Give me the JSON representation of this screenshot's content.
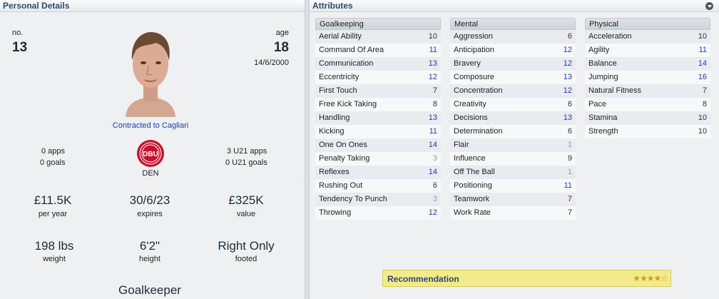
{
  "left_panel": {
    "title": "Personal Details",
    "no_label": "no.",
    "no_value": "13",
    "age_label": "age",
    "age_value": "18",
    "dob": "14/6/2000",
    "contract_text": "Contracted to Cagliari",
    "apps": "0 apps",
    "goals": "0 goals",
    "nation": "DEN",
    "u21_apps": "3 U21 apps",
    "u21_goals": "0 U21 goals",
    "wage_value": "£11.5K",
    "wage_label": "per year",
    "expires_value": "30/6/23",
    "expires_label": "expires",
    "value_value": "£325K",
    "value_label": "value",
    "weight_value": "198 lbs",
    "weight_label": "weight",
    "height_value": "6'2\"",
    "height_label": "height",
    "footed_value": "Right Only",
    "footed_label": "footed",
    "position": "Goalkeeper",
    "badge_text": "DBU"
  },
  "right_panel": {
    "title": "Attributes",
    "columns": [
      {
        "header": "Goalkeeping",
        "rows": [
          {
            "name": "Aerial Ability",
            "value": "10",
            "tone": "dark"
          },
          {
            "name": "Command Of Area",
            "value": "11",
            "tone": "blue"
          },
          {
            "name": "Communication",
            "value": "13",
            "tone": "blue"
          },
          {
            "name": "Eccentricity",
            "value": "12",
            "tone": "blue"
          },
          {
            "name": "First Touch",
            "value": "7",
            "tone": "dark"
          },
          {
            "name": "Free Kick Taking",
            "value": "8",
            "tone": "dark"
          },
          {
            "name": "Handling",
            "value": "13",
            "tone": "blue"
          },
          {
            "name": "Kicking",
            "value": "11",
            "tone": "blue"
          },
          {
            "name": "One On Ones",
            "value": "14",
            "tone": "blue"
          },
          {
            "name": "Penalty Taking",
            "value": "3",
            "tone": "gray"
          },
          {
            "name": "Reflexes",
            "value": "14",
            "tone": "blue"
          },
          {
            "name": "Rushing Out",
            "value": "6",
            "tone": "dark"
          },
          {
            "name": "Tendency To Punch",
            "value": "3",
            "tone": "gray"
          },
          {
            "name": "Throwing",
            "value": "12",
            "tone": "blue"
          }
        ]
      },
      {
        "header": "Mental",
        "rows": [
          {
            "name": "Aggression",
            "value": "6",
            "tone": "dark"
          },
          {
            "name": "Anticipation",
            "value": "12",
            "tone": "blue"
          },
          {
            "name": "Bravery",
            "value": "12",
            "tone": "blue"
          },
          {
            "name": "Composure",
            "value": "13",
            "tone": "blue"
          },
          {
            "name": "Concentration",
            "value": "12",
            "tone": "blue"
          },
          {
            "name": "Creativity",
            "value": "6",
            "tone": "dark"
          },
          {
            "name": "Decisions",
            "value": "13",
            "tone": "blue"
          },
          {
            "name": "Determination",
            "value": "6",
            "tone": "dark"
          },
          {
            "name": "Flair",
            "value": "1",
            "tone": "gray"
          },
          {
            "name": "Influence",
            "value": "9",
            "tone": "dark"
          },
          {
            "name": "Off The Ball",
            "value": "1",
            "tone": "gray"
          },
          {
            "name": "Positioning",
            "value": "11",
            "tone": "blue"
          },
          {
            "name": "Teamwork",
            "value": "7",
            "tone": "dark"
          },
          {
            "name": "Work Rate",
            "value": "7",
            "tone": "dark"
          }
        ]
      },
      {
        "header": "Physical",
        "rows": [
          {
            "name": "Acceleration",
            "value": "10",
            "tone": "dark"
          },
          {
            "name": "Agility",
            "value": "11",
            "tone": "blue"
          },
          {
            "name": "Balance",
            "value": "14",
            "tone": "blue"
          },
          {
            "name": "Jumping",
            "value": "16",
            "tone": "blue"
          },
          {
            "name": "Natural Fitness",
            "value": "7",
            "tone": "dark"
          },
          {
            "name": "Pace",
            "value": "8",
            "tone": "dark"
          },
          {
            "name": "Stamina",
            "value": "10",
            "tone": "dark"
          },
          {
            "name": "Strength",
            "value": "10",
            "tone": "dark"
          }
        ]
      }
    ],
    "recommendation_label": "Recommendation",
    "recommendation_stars": "★★★★☆"
  },
  "icons": {
    "collapse": "chevron-down-icon",
    "photo": "player-photo",
    "badge": "nation-badge-icon"
  }
}
